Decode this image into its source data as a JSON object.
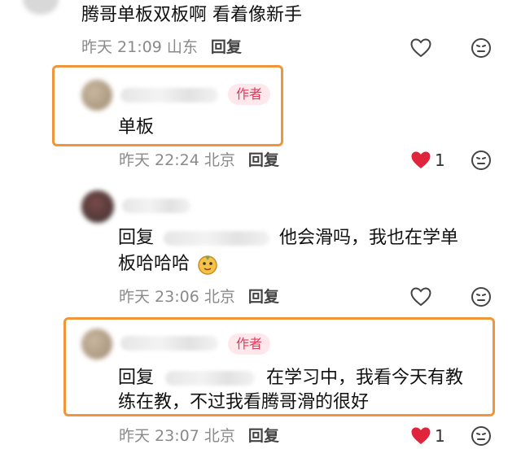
{
  "comments": [
    {
      "text": "腾哥单板双板啊 看着像新手",
      "time": "昨天 21:09",
      "location": "山东",
      "reply_label": "回复"
    },
    {
      "author_tag": "作者",
      "text": "单板",
      "time": "昨天 22:24",
      "location": "北京",
      "reply_label": "回复",
      "likes": "1",
      "liked": true
    },
    {
      "reply_prefix": "回复",
      "text_line1": "他会滑吗，我也在学单",
      "text_line2": "板哈哈哈",
      "time": "昨天 23:06",
      "location": "北京",
      "reply_label": "回复"
    },
    {
      "author_tag": "作者",
      "reply_prefix": "回复",
      "text_line1": "在学习中，我看今天有教",
      "text_line2": "练在教，不过我看腾哥滑的很好",
      "time": "昨天 23:07",
      "location": "北京",
      "reply_label": "回复",
      "likes": "1",
      "liked": true
    }
  ],
  "colors": {
    "highlight": "#f0953a",
    "author_tag_bg": "#ffe8ec",
    "author_tag_text": "#e2395b",
    "liked_heart": "#e0243c"
  },
  "icons": [
    "heart-outline-icon",
    "heart-filled-icon",
    "emoji-face-icon",
    "doge-emoji-icon"
  ]
}
